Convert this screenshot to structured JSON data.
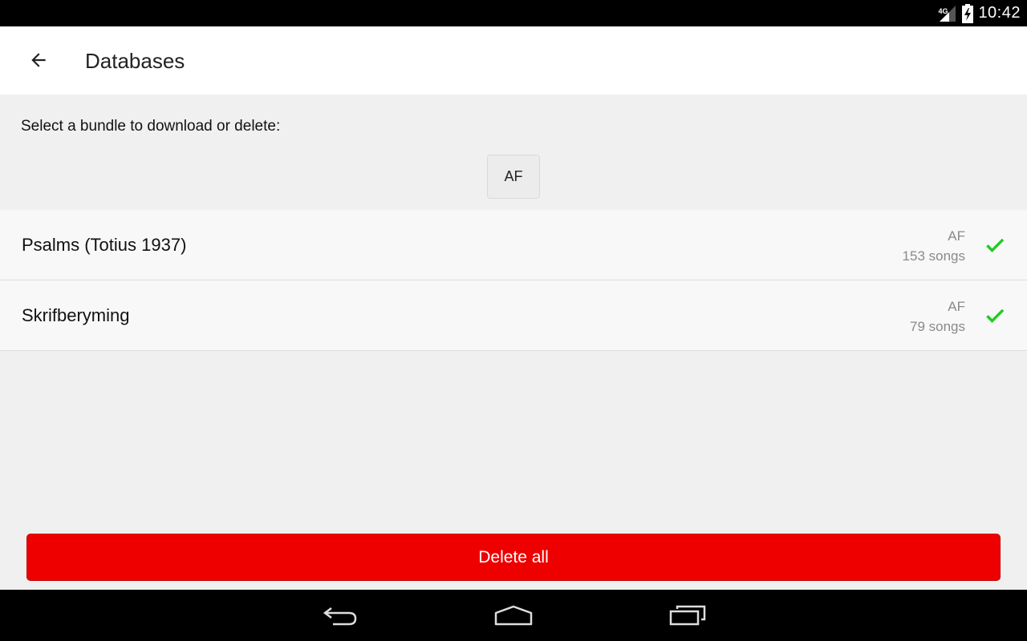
{
  "status_bar": {
    "network_type": "4G",
    "time": "10:42",
    "icons": [
      "signal-icon",
      "battery-charging-icon"
    ]
  },
  "app_bar": {
    "back_icon": "arrow-left-icon",
    "title": "Databases"
  },
  "content": {
    "instruction": "Select a bundle to download or delete:",
    "bundles": [
      {
        "label": "AF"
      }
    ],
    "databases": [
      {
        "name": "Psalms (Totius 1937)",
        "language": "AF",
        "songs": "153 songs",
        "status_icon": "check-icon"
      },
      {
        "name": "Skrifberyming",
        "language": "AF",
        "songs": "79 songs",
        "status_icon": "check-icon"
      }
    ],
    "delete_all_label": "Delete all"
  },
  "nav_bar": {
    "icons": [
      "back-nav-icon",
      "home-icon",
      "recents-icon"
    ]
  },
  "colors": {
    "accent_red": "#ee0000",
    "check_green": "#22cc22"
  }
}
